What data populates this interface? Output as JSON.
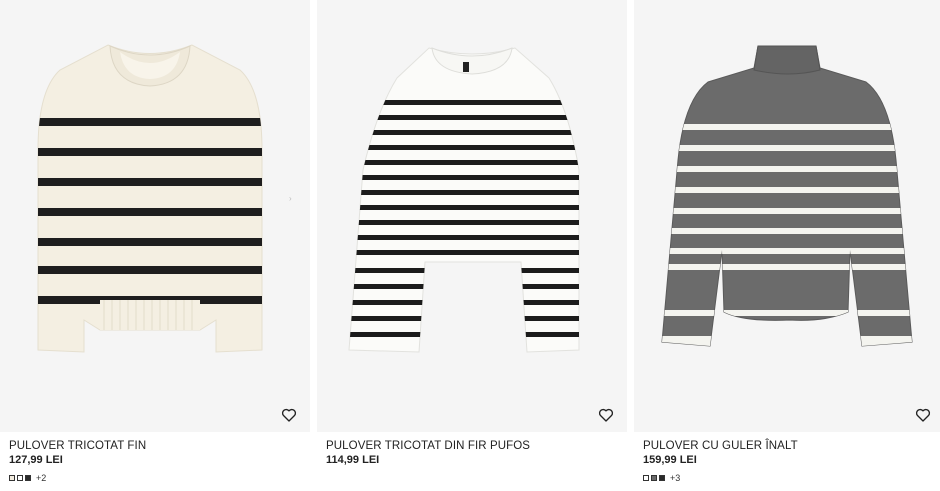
{
  "products": [
    {
      "name": "PULOVER TRICOTAT FIN",
      "price": "127,99 LEI",
      "more_colors": "+2",
      "swatch_colors": [
        "#f3ede0",
        "#ffffff",
        "#2a2a2a"
      ],
      "favorite_icon": "heart-icon"
    },
    {
      "name": "PULOVER TRICOTAT DIN FIR PUFOS",
      "price": "114,99 LEI",
      "favorite_icon": "heart-icon"
    },
    {
      "name": "PULOVER CU GULER ÎNALT",
      "price": "159,99 LEI",
      "more_colors": "+3",
      "swatch_colors": [
        "#ffffff",
        "#6a6a6a",
        "#2a2a2a"
      ],
      "favorite_icon": "heart-icon"
    }
  ],
  "colors": {
    "image_bg": "#f5f5f5",
    "text": "#222222"
  }
}
